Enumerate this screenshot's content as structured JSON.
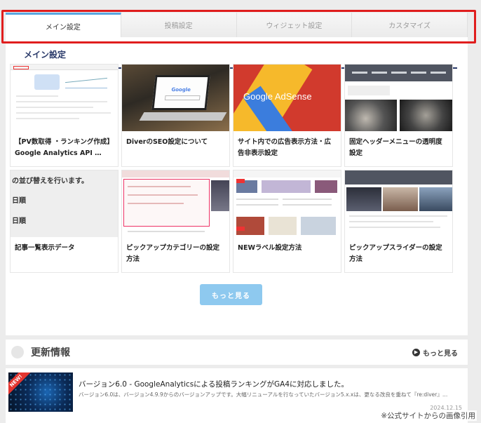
{
  "tabs": [
    {
      "label": "メイン設定",
      "active": true
    },
    {
      "label": "投稿設定",
      "active": false
    },
    {
      "label": "ウィジェット設定",
      "active": false
    },
    {
      "label": "カスタマイズ",
      "active": false
    }
  ],
  "section_title": "メイン設定",
  "cards": [
    {
      "title": "【PV数取得 ・ランキング作成】Google Analytics API …",
      "thumb": "screenshot-thumbnail"
    },
    {
      "title": "DiverのSEO設定について",
      "thumb": "laptop-photo-thumbnail"
    },
    {
      "title": "サイト内での広告表示方法・広告非表示設定",
      "thumb": "adsense-thumbnail",
      "thumb_text": "Google AdSense"
    },
    {
      "title": "固定ヘッダーメニューの透明度設定",
      "thumb": "fixed-header-thumbnail"
    },
    {
      "title": "記事一覧表示データ",
      "thumb": "article-list-thumbnail",
      "thumb_lines": [
        "の並び替えを行います。",
        "日順",
        "日順"
      ]
    },
    {
      "title": "ピックアップカテゴリーの設定方法",
      "thumb": "pickup-category-thumbnail"
    },
    {
      "title": "NEWラベル設定方法",
      "thumb": "new-label-thumbnail"
    },
    {
      "title": "ピックアップスライダーの設定方法",
      "thumb": "pickup-slider-thumbnail"
    }
  ],
  "more_button": "もっと見る",
  "updates": {
    "title": "更新情報",
    "more_link": "もっと見る",
    "item": {
      "badge": "NEW!",
      "title": "バージョン6.0 - GoogleAnalyticsによる投稿ランキングがGA4に対応しました。",
      "excerpt": "バージョン6.0は、バージョン4.9.9からのバージョンアップです。大幅リニューアルを行なっていたバージョン5.x.xは、更なる改良を重ねて『re:diver』…",
      "date": "2024.12.15"
    }
  },
  "source_note": "※公式サイトからの画像引用",
  "colors": {
    "highlight": "#e01e1e",
    "active_tab": "#5aa7e0",
    "title_underline": "#2a3a6a",
    "more_button": "#8ec9ef"
  }
}
